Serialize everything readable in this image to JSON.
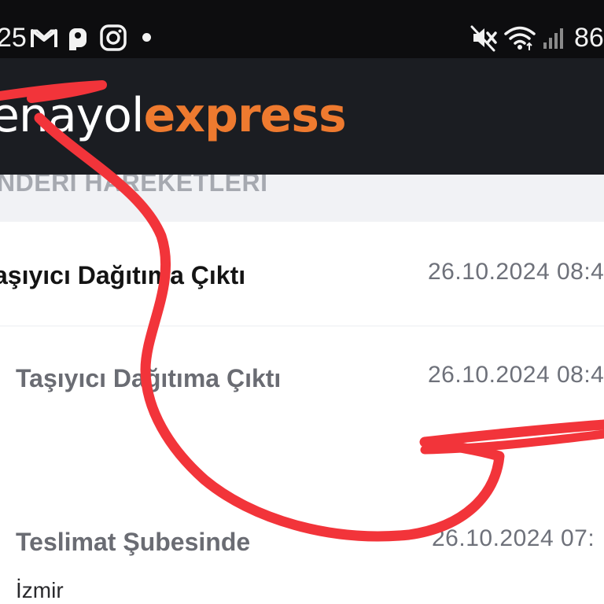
{
  "status_bar": {
    "time": "25",
    "battery": "86",
    "left_icons": [
      "gmail-icon",
      "p-app-icon",
      "instagram-icon",
      "notification-dot-icon"
    ],
    "right_icons": [
      "mute-icon",
      "wifi-icon",
      "signal-icon"
    ]
  },
  "header": {
    "brand_part1": "enayol",
    "brand_part2": "express",
    "brand_color": "#ee7a2f"
  },
  "section": {
    "title": "NDERI HAREKETLERI"
  },
  "events": [
    {
      "title": "aşıyıcı Dağıtıma Çıktı",
      "date": "26.10.2024 08:4"
    },
    {
      "title": "Taşıyıcı Dağıtıma Çıktı",
      "date": "26.10.2024 08:4"
    },
    {
      "title": "Teslimat Şubesinde",
      "date": "26.10.2024 07:",
      "location": "İzmir"
    }
  ],
  "colors": {
    "status_bar_bg": "#0d0d0f",
    "header_bg": "#1b1d22",
    "scribble": "#f2343a"
  }
}
